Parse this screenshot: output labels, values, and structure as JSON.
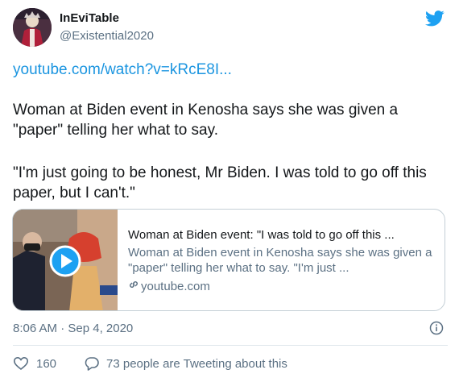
{
  "user": {
    "display_name": "InEviTable",
    "handle": "@Existential2020"
  },
  "tweet": {
    "link_text": "youtube.com/watch?v=kRcE8I...",
    "paragraph1": "Woman at Biden event in Kenosha says she was given a \"paper\" telling her what to say.",
    "paragraph2": "\"I'm just going to be honest, Mr Biden. I was told to go off this paper, but I can't.\""
  },
  "card": {
    "title": "Woman at Biden event: \"I was told to go off this ...",
    "description": "Woman at Biden event in Kenosha says she was given a \"paper\" telling her what to say. \"I'm just ...",
    "domain": "youtube.com"
  },
  "timestamp": "8:06 AM · Sep 4, 2020",
  "actions": {
    "likes": "160",
    "conversation": "73 people are Tweeting about this"
  },
  "colors": {
    "accent": "#1b95e0",
    "text": "#14171a",
    "secondary": "#5b7083"
  },
  "icons": [
    "twitter-bird-icon",
    "play-icon",
    "link-icon",
    "info-icon",
    "heart-icon",
    "speech-bubble-icon"
  ]
}
